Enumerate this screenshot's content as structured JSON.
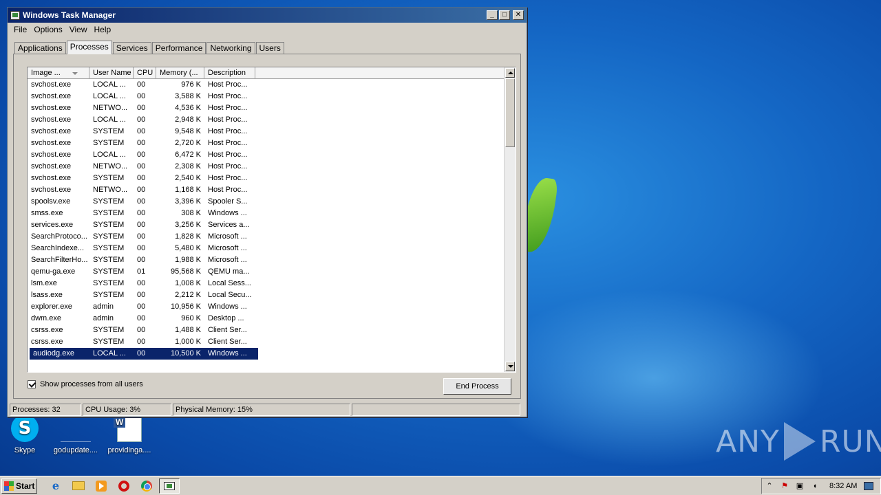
{
  "window": {
    "title": "Windows Task Manager",
    "minimize": "_",
    "maximize": "□",
    "close": "✕"
  },
  "menu": [
    "File",
    "Options",
    "View",
    "Help"
  ],
  "tabs": [
    {
      "label": "Applications",
      "active": false
    },
    {
      "label": "Processes",
      "active": true
    },
    {
      "label": "Services",
      "active": false
    },
    {
      "label": "Performance",
      "active": false
    },
    {
      "label": "Networking",
      "active": false
    },
    {
      "label": "Users",
      "active": false
    }
  ],
  "columns": [
    "Image ...",
    "User Name",
    "CPU",
    "Memory (...",
    "Description"
  ],
  "processes": [
    {
      "image": "svchost.exe",
      "user": "LOCAL ...",
      "cpu": "00",
      "memory": "976 K",
      "description": "Host Proc..."
    },
    {
      "image": "svchost.exe",
      "user": "LOCAL ...",
      "cpu": "00",
      "memory": "3,588 K",
      "description": "Host Proc..."
    },
    {
      "image": "svchost.exe",
      "user": "NETWO...",
      "cpu": "00",
      "memory": "4,536 K",
      "description": "Host Proc..."
    },
    {
      "image": "svchost.exe",
      "user": "LOCAL ...",
      "cpu": "00",
      "memory": "2,948 K",
      "description": "Host Proc..."
    },
    {
      "image": "svchost.exe",
      "user": "SYSTEM",
      "cpu": "00",
      "memory": "9,548 K",
      "description": "Host Proc..."
    },
    {
      "image": "svchost.exe",
      "user": "SYSTEM",
      "cpu": "00",
      "memory": "2,720 K",
      "description": "Host Proc..."
    },
    {
      "image": "svchost.exe",
      "user": "LOCAL ...",
      "cpu": "00",
      "memory": "6,472 K",
      "description": "Host Proc..."
    },
    {
      "image": "svchost.exe",
      "user": "NETWO...",
      "cpu": "00",
      "memory": "2,308 K",
      "description": "Host Proc..."
    },
    {
      "image": "svchost.exe",
      "user": "SYSTEM",
      "cpu": "00",
      "memory": "2,540 K",
      "description": "Host Proc..."
    },
    {
      "image": "svchost.exe",
      "user": "NETWO...",
      "cpu": "00",
      "memory": "1,168 K",
      "description": "Host Proc..."
    },
    {
      "image": "spoolsv.exe",
      "user": "SYSTEM",
      "cpu": "00",
      "memory": "3,396 K",
      "description": "Spooler S..."
    },
    {
      "image": "smss.exe",
      "user": "SYSTEM",
      "cpu": "00",
      "memory": "308 K",
      "description": "Windows ..."
    },
    {
      "image": "services.exe",
      "user": "SYSTEM",
      "cpu": "00",
      "memory": "3,256 K",
      "description": "Services a..."
    },
    {
      "image": "SearchProtoco...",
      "user": "SYSTEM",
      "cpu": "00",
      "memory": "1,828 K",
      "description": "Microsoft ..."
    },
    {
      "image": "SearchIndexe...",
      "user": "SYSTEM",
      "cpu": "00",
      "memory": "5,480 K",
      "description": "Microsoft ..."
    },
    {
      "image": "SearchFilterHo...",
      "user": "SYSTEM",
      "cpu": "00",
      "memory": "1,988 K",
      "description": "Microsoft ..."
    },
    {
      "image": "qemu-ga.exe",
      "user": "SYSTEM",
      "cpu": "01",
      "memory": "95,568 K",
      "description": "QEMU ma..."
    },
    {
      "image": "lsm.exe",
      "user": "SYSTEM",
      "cpu": "00",
      "memory": "1,008 K",
      "description": "Local Sess..."
    },
    {
      "image": "lsass.exe",
      "user": "SYSTEM",
      "cpu": "00",
      "memory": "2,212 K",
      "description": "Local Secu..."
    },
    {
      "image": "explorer.exe",
      "user": "admin",
      "cpu": "00",
      "memory": "10,956 K",
      "description": "Windows ..."
    },
    {
      "image": "dwm.exe",
      "user": "admin",
      "cpu": "00",
      "memory": "960 K",
      "description": "Desktop ..."
    },
    {
      "image": "csrss.exe",
      "user": "SYSTEM",
      "cpu": "00",
      "memory": "1,488 K",
      "description": "Client Ser..."
    },
    {
      "image": "csrss.exe",
      "user": "SYSTEM",
      "cpu": "00",
      "memory": "1,000 K",
      "description": "Client Ser..."
    },
    {
      "image": "audiodg.exe",
      "user": "LOCAL ...",
      "cpu": "00",
      "memory": "10,500 K",
      "description": "Windows ...",
      "selected": true
    }
  ],
  "show_all_users_label": "Show processes from all users",
  "show_all_users_checked": true,
  "end_process_label": "End Process",
  "status": {
    "processes": "Processes: 32",
    "cpu": "CPU Usage: 3%",
    "memory": "Physical Memory: 15%"
  },
  "desktop_icons": [
    {
      "label": "Skype",
      "icon": "skype-icon"
    },
    {
      "label": "godupdate....",
      "icon": "file-icon"
    },
    {
      "label": "providinga....",
      "icon": "word-document-icon"
    }
  ],
  "watermark": {
    "left": "ANY",
    "right": "RUN"
  },
  "taskbar": {
    "start_label": "Start",
    "clock": "8:32 AM",
    "tray_chevron": "⌃"
  },
  "colors": {
    "selection": "#0a246a",
    "titlebar": "#0a246a",
    "desktop": "#1466c4"
  }
}
